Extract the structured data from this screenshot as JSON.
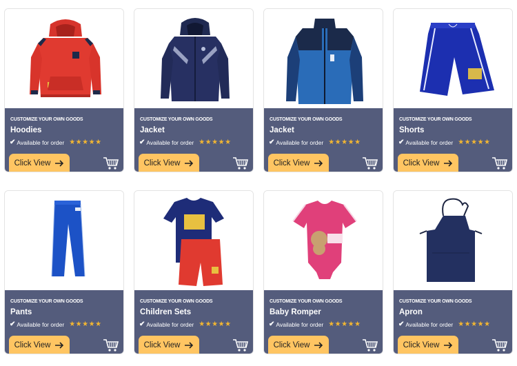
{
  "products": [
    {
      "tagline": "CUSTOMIZE YOUR OWN GOODS",
      "name": "Hoodies",
      "availability": "Available for order",
      "rating": "★★★★★",
      "button": "Click View",
      "image": "red-hoodie"
    },
    {
      "tagline": "CUSTOMIZE YOUR OWN GOODS",
      "name": "Jacket",
      "availability": "Available for order",
      "rating": "★★★★★",
      "button": "Click View",
      "image": "navy-hooded-jacket"
    },
    {
      "tagline": "CUSTOMIZE YOUR OWN GOODS",
      "name": "Jacket",
      "availability": "Available for order",
      "rating": "★★★★★",
      "button": "Click View",
      "image": "blue-zip-jacket"
    },
    {
      "tagline": "CUSTOMIZE YOUR OWN GOODS",
      "name": "Shorts",
      "availability": "Available for order",
      "rating": "★★★★★",
      "button": "Click View",
      "image": "blue-shorts"
    },
    {
      "tagline": "CUSTOMIZE YOUR OWN GOODS",
      "name": "Pants",
      "availability": "Available for order",
      "rating": "★★★★★",
      "button": "Click View",
      "image": "blue-pants"
    },
    {
      "tagline": "CUSTOMIZE YOUR OWN GOODS",
      "name": "Children Sets",
      "availability": "Available for order",
      "rating": "★★★★★",
      "button": "Click View",
      "image": "kids-tshirt-shorts-set"
    },
    {
      "tagline": "CUSTOMIZE YOUR OWN GOODS",
      "name": "Baby Romper",
      "availability": "Available for order",
      "rating": "★★★★★",
      "button": "Click View",
      "image": "pink-baby-romper"
    },
    {
      "tagline": "CUSTOMIZE YOUR OWN GOODS",
      "name": "Apron",
      "availability": "Available for order",
      "rating": "★★★★★",
      "button": "Click View",
      "image": "navy-apron"
    }
  ],
  "colors": {
    "panel": "#545c7c",
    "button": "#ffc562",
    "stars": "#f2b632"
  }
}
